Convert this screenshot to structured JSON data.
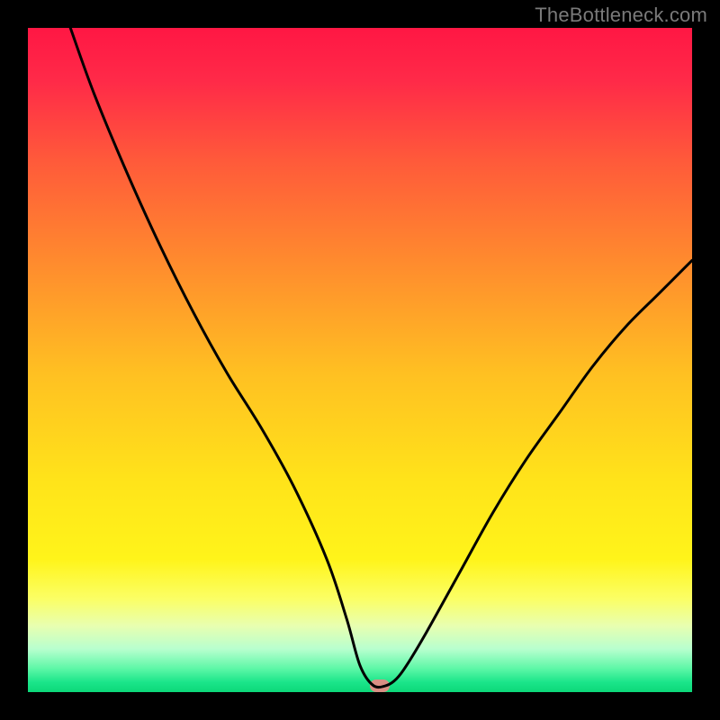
{
  "watermark": "TheBottleneck.com",
  "chart_data": {
    "type": "line",
    "title": "",
    "xlabel": "",
    "ylabel": "",
    "xlim": [
      0,
      100
    ],
    "ylim": [
      0,
      100
    ],
    "series": [
      {
        "name": "bottleneck-curve",
        "x": [
          6.4,
          10,
          15,
          20,
          25,
          30,
          35,
          40,
          45,
          48,
          50,
          52,
          54,
          55.5,
          57,
          60,
          65,
          70,
          75,
          80,
          85,
          90,
          95,
          100
        ],
        "y": [
          100,
          90,
          78,
          67,
          57,
          48,
          40,
          31,
          20,
          11,
          4,
          1,
          1,
          2,
          4,
          9,
          18,
          27,
          35,
          42,
          49,
          55,
          60,
          65
        ]
      }
    ],
    "optimum_point": {
      "x": 53,
      "y": 1
    },
    "gradient_stops": [
      {
        "offset": 0.0,
        "color": "#ff1744"
      },
      {
        "offset": 0.08,
        "color": "#ff2a48"
      },
      {
        "offset": 0.2,
        "color": "#ff5a3a"
      },
      {
        "offset": 0.35,
        "color": "#ff8a2e"
      },
      {
        "offset": 0.52,
        "color": "#ffc022"
      },
      {
        "offset": 0.68,
        "color": "#ffe31a"
      },
      {
        "offset": 0.8,
        "color": "#fff41a"
      },
      {
        "offset": 0.86,
        "color": "#fbff66"
      },
      {
        "offset": 0.9,
        "color": "#e8ffb0"
      },
      {
        "offset": 0.935,
        "color": "#b8ffcf"
      },
      {
        "offset": 0.965,
        "color": "#5cf7a6"
      },
      {
        "offset": 0.985,
        "color": "#1be58a"
      },
      {
        "offset": 1.0,
        "color": "#0cd879"
      }
    ]
  }
}
